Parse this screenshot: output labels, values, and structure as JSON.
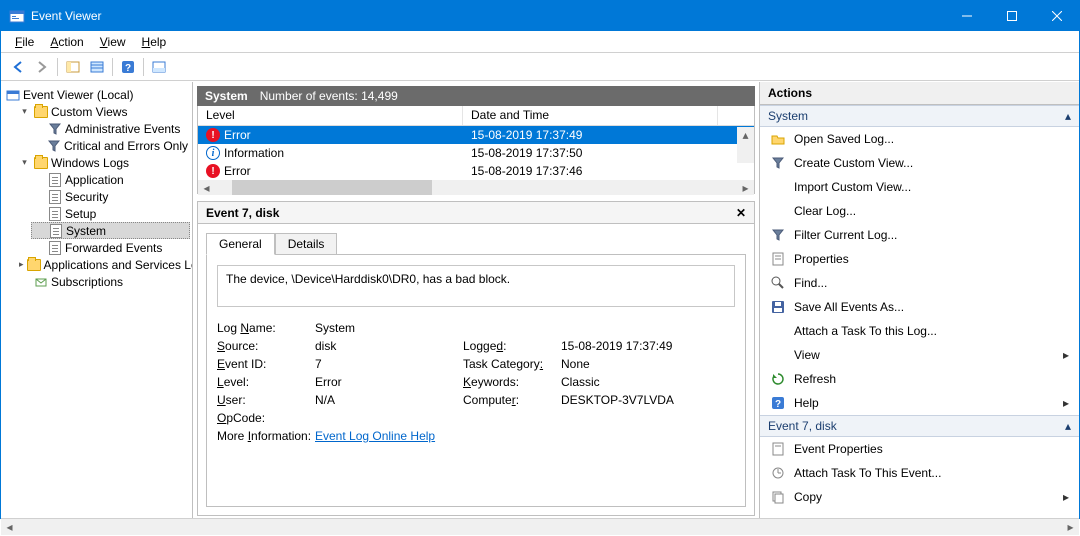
{
  "title": "Event Viewer",
  "menus": [
    "File",
    "Action",
    "View",
    "Help"
  ],
  "tree": {
    "root": "Event Viewer (Local)",
    "customViews": "Custom Views",
    "adminEvents": "Administrative Events",
    "critErr": "Critical and Errors Only",
    "winLogs": "Windows Logs",
    "app": "Application",
    "sec": "Security",
    "setup": "Setup",
    "system": "System",
    "forwarded": "Forwarded Events",
    "appServ": "Applications and Services Lo",
    "subs": "Subscriptions"
  },
  "listHeader": {
    "title": "System",
    "count": "Number of events: 14,499",
    "colLevel": "Level",
    "colDate": "Date and Time"
  },
  "events": [
    {
      "level": "Error",
      "date": "15-08-2019 17:37:49",
      "kind": "err"
    },
    {
      "level": "Information",
      "date": "15-08-2019 17:37:50",
      "kind": "info"
    },
    {
      "level": "Error",
      "date": "15-08-2019 17:37:46",
      "kind": "err"
    }
  ],
  "detail": {
    "title": "Event 7, disk",
    "tabGeneral": "General",
    "tabDetails": "Details",
    "message": "The device, \\Device\\Harddisk0\\DR0, has a bad block.",
    "logNameL": "Log Name:",
    "logNameV": "System",
    "sourceL": "Source:",
    "sourceV": "disk",
    "loggedL": "Logged:",
    "loggedV": "15-08-2019 17:37:49",
    "eventIdL": "Event ID:",
    "eventIdV": "7",
    "taskCatL": "Task Category:",
    "taskCatV": "None",
    "levelL": "Level:",
    "levelV": "Error",
    "keywordsL": "Keywords:",
    "keywordsV": "Classic",
    "userL": "User:",
    "userV": "N/A",
    "computerL": "Computer:",
    "computerV": "DESKTOP-3V7LVDA",
    "opcodeL": "OpCode:",
    "moreInfoL": "More Information:",
    "moreInfoLink": "Event Log Online Help"
  },
  "actions": {
    "title": "Actions",
    "section1": "System",
    "openSaved": "Open Saved Log...",
    "createCV": "Create Custom View...",
    "importCV": "Import Custom View...",
    "clearLog": "Clear Log...",
    "filter": "Filter Current Log...",
    "properties": "Properties",
    "find": "Find...",
    "saveAll": "Save All Events As...",
    "attachTask": "Attach a Task To this Log...",
    "view": "View",
    "refresh": "Refresh",
    "help": "Help",
    "section2": "Event 7, disk",
    "evtProps": "Event Properties",
    "attachToEvt": "Attach Task To This Event...",
    "copy": "Copy"
  }
}
